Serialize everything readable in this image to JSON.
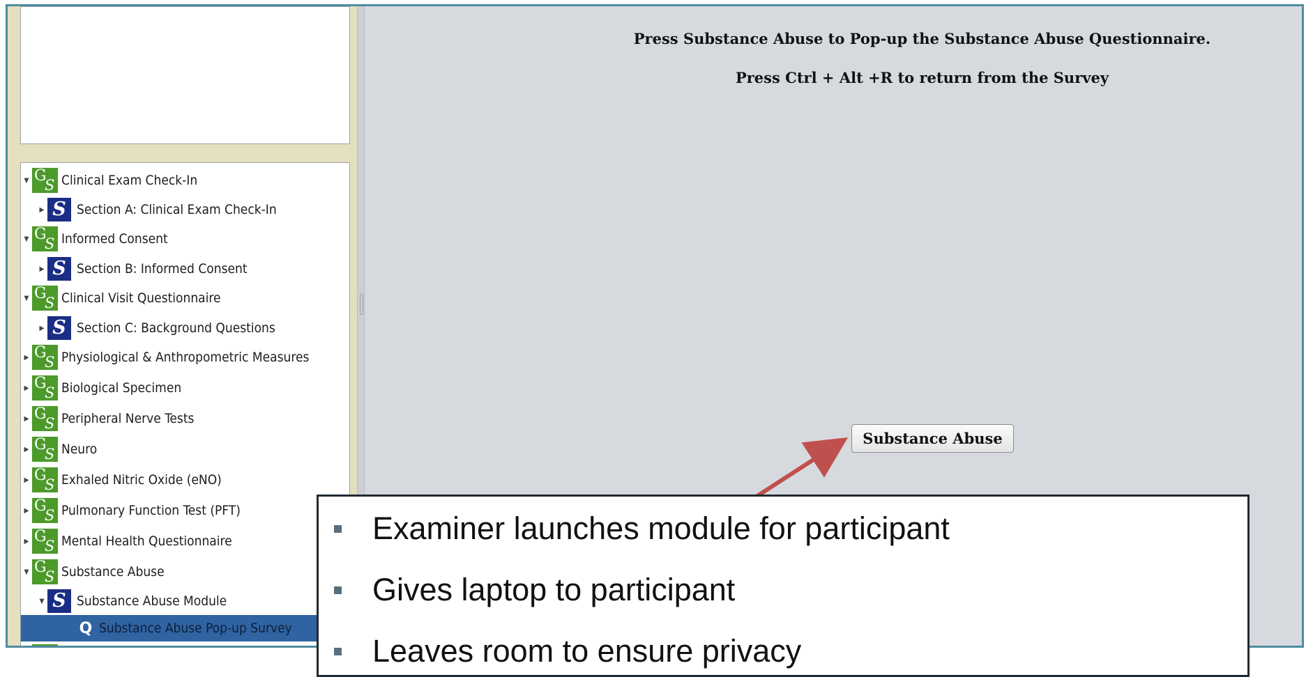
{
  "main": {
    "instruction_line1": "Press Substance Abuse to Pop-up the Substance Abuse Questionnaire.",
    "instruction_line2": "Press Ctrl + Alt +R to return from the Survey",
    "button_label": "Substance Abuse"
  },
  "tree": [
    {
      "label": "Clinical Exam Check-In",
      "icon": "gs-icon",
      "expanded": true
    },
    {
      "label": "Section A: Clinical Exam Check-In",
      "icon": "section-icon",
      "expanded": false
    },
    {
      "label": "Informed Consent",
      "icon": "gs-icon",
      "expanded": true
    },
    {
      "label": "Section B: Informed Consent",
      "icon": "section-icon",
      "expanded": false
    },
    {
      "label": "Clinical Visit Questionnaire",
      "icon": "gs-icon",
      "expanded": true
    },
    {
      "label": "Section C: Background Questions",
      "icon": "section-icon",
      "expanded": false
    },
    {
      "label": "Physiological & Anthropometric Measures",
      "icon": "gs-icon",
      "expanded": false
    },
    {
      "label": "Biological Specimen",
      "icon": "gs-icon",
      "expanded": false
    },
    {
      "label": "Peripheral Nerve Tests",
      "icon": "gs-icon",
      "expanded": false
    },
    {
      "label": "Neuro",
      "icon": "gs-icon",
      "expanded": false
    },
    {
      "label": "Exhaled Nitric Oxide (eNO)",
      "icon": "gs-icon",
      "expanded": false
    },
    {
      "label": "Pulmonary Function Test (PFT)",
      "icon": "gs-icon",
      "expanded": false
    },
    {
      "label": "Mental Health Questionnaire",
      "icon": "gs-icon",
      "expanded": false
    },
    {
      "label": "Substance Abuse",
      "icon": "gs-icon",
      "expanded": true
    },
    {
      "label": "Substance Abuse Module",
      "icon": "section-icon",
      "expanded": true
    },
    {
      "label": "Substance Abuse Pop-up Survey",
      "icon": "question-icon",
      "selected": true
    }
  ],
  "callout": {
    "bullets": [
      "Examiner launches module for participant",
      "Gives laptop to participant",
      "Leaves room to ensure privacy"
    ]
  },
  "colors": {
    "window_border": "#4f8ba0",
    "gs_icon": "#4c9a2a",
    "section_icon": "#1b2e85",
    "selection": "#2f63a1",
    "arrow": "#c0504d"
  }
}
